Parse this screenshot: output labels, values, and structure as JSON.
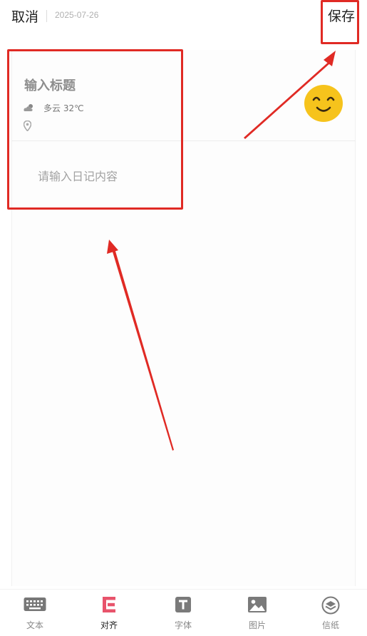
{
  "header": {
    "cancel_label": "取消",
    "date": "2025-07-26",
    "save_label": "保存"
  },
  "editor": {
    "title_placeholder": "输入标题",
    "weather_text": "多云 32℃",
    "content_placeholder": "请输入日记内容",
    "mood_icon": "smile-emoji-icon",
    "weather_icon": "cloud-icon",
    "location_icon": "location-pin-icon"
  },
  "toolbar": {
    "items": [
      {
        "label": "文本",
        "icon": "keyboard-icon"
      },
      {
        "label": "对齐",
        "icon": "align-icon"
      },
      {
        "label": "字体",
        "icon": "font-icon"
      },
      {
        "label": "图片",
        "icon": "image-icon"
      },
      {
        "label": "信纸",
        "icon": "stationery-icon"
      }
    ]
  },
  "colors": {
    "annotation_red": "#e02a24",
    "emoji_yellow": "#f6c31c",
    "active_tool": "#e8536b"
  }
}
